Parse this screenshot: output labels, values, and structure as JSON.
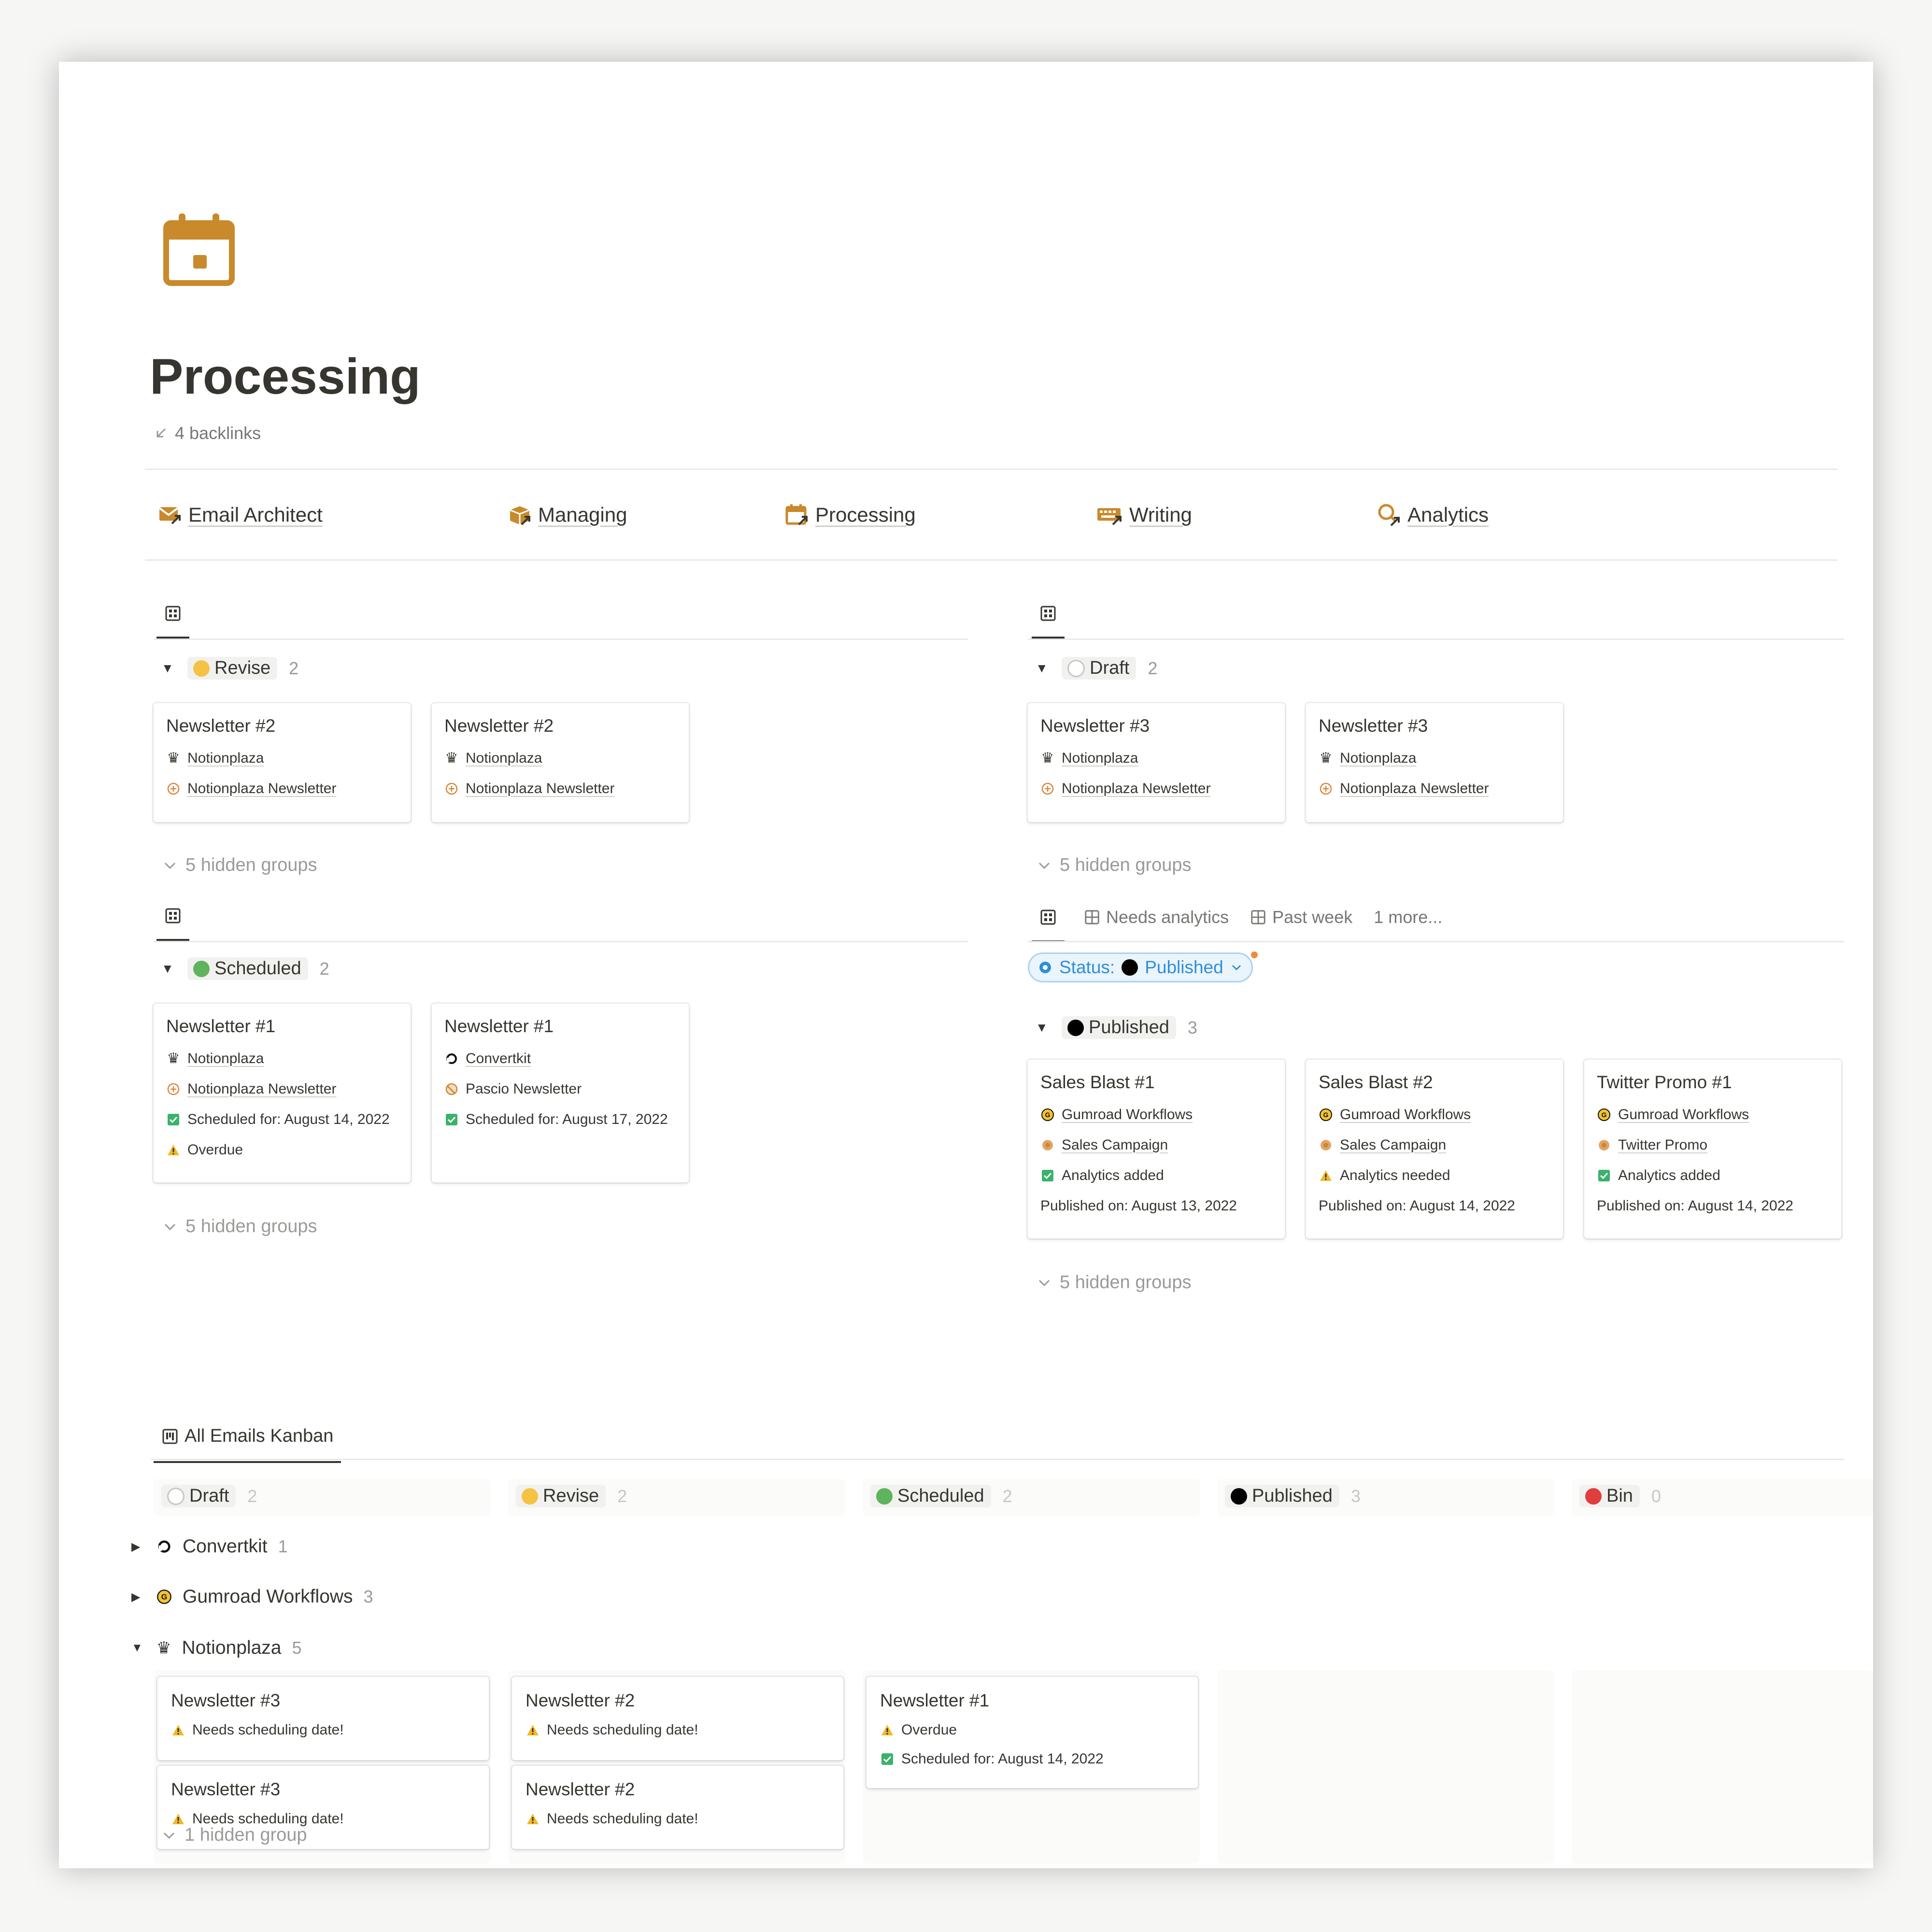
{
  "page": {
    "title": "Processing",
    "backlinks": "4 backlinks"
  },
  "nav": [
    {
      "label": "Email Architect",
      "icon": "email-architect-icon"
    },
    {
      "label": "Managing",
      "icon": "managing-box-icon"
    },
    {
      "label": "Processing",
      "icon": "processing-calendar-icon"
    },
    {
      "label": "Writing",
      "icon": "writing-keyboard-icon"
    },
    {
      "label": "Analytics",
      "icon": "analytics-search-icon"
    }
  ],
  "colors": {
    "accent": "#c98a2b",
    "revise": "#f5c242",
    "scheduled": "#5db45c",
    "published": "#000000",
    "bin": "#e03e3e",
    "filter": "#2f8fd8"
  },
  "revise_view": {
    "group": "Revise",
    "count": "2",
    "cards": [
      {
        "title": "Newsletter #2",
        "account": "Notionplaza",
        "campaign": "Notionplaza Newsletter"
      },
      {
        "title": "Newsletter #2",
        "account": "Notionplaza",
        "campaign": "Notionplaza Newsletter"
      }
    ],
    "hidden": "5 hidden groups"
  },
  "draft_view": {
    "group": "Draft",
    "count": "2",
    "cards": [
      {
        "title": "Newsletter #3",
        "account": "Notionplaza",
        "campaign": "Notionplaza Newsletter"
      },
      {
        "title": "Newsletter #3",
        "account": "Notionplaza",
        "campaign": "Notionplaza Newsletter"
      }
    ],
    "hidden": "5 hidden groups"
  },
  "scheduled_view": {
    "group": "Scheduled",
    "count": "2",
    "cards": [
      {
        "title": "Newsletter #1",
        "account": "Notionplaza",
        "campaign": "Notionplaza Newsletter",
        "scheduled": "Scheduled for: August 14, 2022",
        "warning": "Overdue"
      },
      {
        "title": "Newsletter #1",
        "account": "Convertkit",
        "campaign": "Pascio Newsletter",
        "scheduled": "Scheduled for: August 17, 2022"
      }
    ],
    "hidden": "5 hidden groups"
  },
  "published_view": {
    "tabs": [
      "Needs analytics",
      "Past week",
      "1 more..."
    ],
    "filter": {
      "label": "Status:",
      "value": "Published"
    },
    "group": "Published",
    "count": "3",
    "cards": [
      {
        "title": "Sales Blast #1",
        "account": "Gumroad Workflows",
        "campaign": "Sales Campaign",
        "analytics": "Analytics added",
        "published": "Published on: August 13, 2022"
      },
      {
        "title": "Sales Blast #2",
        "account": "Gumroad Workflows",
        "campaign": "Sales Campaign",
        "analytics": "Analytics needed",
        "published": "Published on: August 14, 2022"
      },
      {
        "title": "Twitter Promo #1",
        "account": "Gumroad Workflows",
        "campaign": "Twitter Promo",
        "analytics": "Analytics added",
        "published": "Published on: August 14, 2022"
      }
    ],
    "hidden": "5 hidden groups"
  },
  "kanban": {
    "title": "All Emails Kanban",
    "columns": [
      {
        "label": "Draft",
        "count": "2"
      },
      {
        "label": "Revise",
        "count": "2"
      },
      {
        "label": "Scheduled",
        "count": "2"
      },
      {
        "label": "Published",
        "count": "3"
      },
      {
        "label": "Bin",
        "count": "0"
      }
    ],
    "subgroups": [
      {
        "label": "Convertkit",
        "count": "1"
      },
      {
        "label": "Gumroad Workflows",
        "count": "3"
      },
      {
        "label": "Notionplaza",
        "count": "5"
      }
    ],
    "cards": {
      "draft": [
        {
          "title": "Newsletter #3",
          "note": "Needs scheduling date!"
        },
        {
          "title": "Newsletter #3",
          "note": "Needs scheduling date!"
        }
      ],
      "revise": [
        {
          "title": "Newsletter #2",
          "note": "Needs scheduling date!"
        },
        {
          "title": "Newsletter #2",
          "note": "Needs scheduling date!"
        }
      ],
      "scheduled": [
        {
          "title": "Newsletter #1",
          "note": "Overdue",
          "scheduled": "Scheduled for: August 14, 2022"
        }
      ]
    },
    "hidden": "1 hidden group"
  }
}
